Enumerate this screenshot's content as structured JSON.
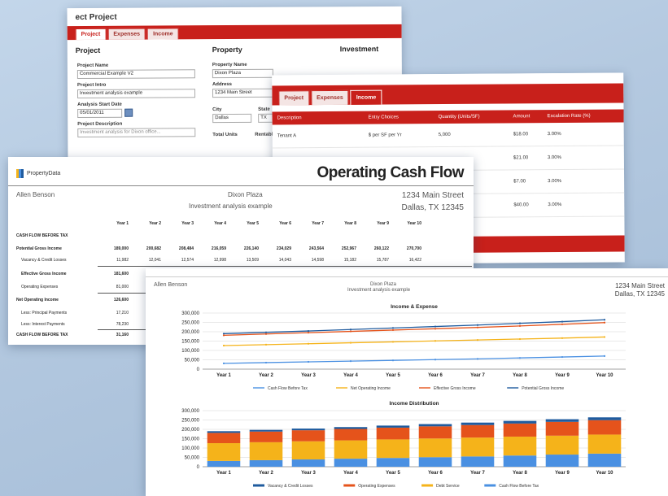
{
  "colors": {
    "brand_red": "#c8201b",
    "series_blue": "#4a90e2",
    "series_yellow": "#f5b31a",
    "series_orange": "#e5531b",
    "series_navy": "#1f5b9e",
    "series_gray": "#8aa0b8"
  },
  "card1": {
    "title": "ect Project",
    "tabs": [
      {
        "label": "Project",
        "active": true
      },
      {
        "label": "Expenses",
        "active": false
      },
      {
        "label": "Income",
        "active": false
      }
    ],
    "section_project": "Project",
    "section_property": "Property",
    "section_investment": "Investment",
    "project_name_label": "Project Name",
    "project_name_value": "Commercial Example V2",
    "project_intro_label": "Project Intro",
    "project_intro_value": "Investment analysis example",
    "analysis_start_label": "Analysis Start Date",
    "analysis_start_value": "05/01/2011",
    "project_desc_label": "Project Description",
    "project_desc_value": "Investment analysis for Dixon office...",
    "property_name_label": "Property Name",
    "property_name_value": "Dixon Plaza",
    "address_label": "Address",
    "address_value": "1234 Main Street",
    "city_label": "City",
    "city_value": "Dallas",
    "state_label": "State",
    "state_value": "TX",
    "total_units_label": "Total Units",
    "rentable_label": "Rentable"
  },
  "card2": {
    "tabs": [
      {
        "label": "Project",
        "active": false
      },
      {
        "label": "Expenses",
        "active": false
      },
      {
        "label": "Income",
        "active": true
      }
    ],
    "columns": [
      "Description",
      "Entry Choices",
      "Quantity (Units/SF)",
      "Amount",
      "Escalation Rate (%)"
    ],
    "rows": [
      [
        "Tenant A",
        "$ per SF per Yr",
        "5,000",
        "$18.00",
        "3.00%"
      ],
      [
        "",
        "",
        "",
        "$21.00",
        "3.00%"
      ],
      [
        "",
        "",
        "",
        "$7.00",
        "3.00%"
      ],
      [
        "",
        "",
        "",
        "$40.00",
        "3.00%"
      ]
    ]
  },
  "card3": {
    "logo_text": "PropertyData",
    "title": "Operating Cash Flow",
    "owner": "Allen Benson",
    "property": "Dixon Plaza",
    "subtitle": "Investment analysis example",
    "address": "1234 Main Street",
    "city_state": "Dallas, TX 12345",
    "years": [
      "Year 1",
      "Year 2",
      "Year 3",
      "Year 4",
      "Year 5",
      "Year 6",
      "Year 7",
      "Year 8",
      "Year 9",
      "Year 10"
    ],
    "section_label": "CASH FLOW BEFORE TAX",
    "rows": [
      {
        "label": "Potential Gross Income",
        "bold": true,
        "values": [
          "189,000",
          "200,682",
          "208,484",
          "216,059",
          "226,140",
          "234,029",
          "243,564",
          "252,967",
          "260,122",
          "270,700"
        ]
      },
      {
        "label": "Vacancy & Credit Losses",
        "bold": false,
        "values": [
          "11,982",
          "12,041",
          "12,574",
          "12,998",
          "13,509",
          "14,043",
          "14,598",
          "15,182",
          "15,787",
          "16,422"
        ]
      },
      {
        "label": "Effective Gross Income",
        "bold": true,
        "values": [
          "181,600"
        ]
      },
      {
        "label": "Operating Expenses",
        "bold": false,
        "values": [
          "81,000"
        ]
      },
      {
        "label": "Net Operating Income",
        "bold": true,
        "values": [
          "126,600"
        ]
      },
      {
        "label": "Less: Principal Payments",
        "bold": false,
        "values": [
          "17,210"
        ]
      },
      {
        "label": "Less: Interest Payments",
        "bold": false,
        "values": [
          "78,230"
        ]
      },
      {
        "label": "CASH FLOW BEFORE TAX",
        "bold": true,
        "values": [
          "31,160"
        ]
      }
    ]
  },
  "card4": {
    "owner": "Allen Benson",
    "property": "Dixon Plaza",
    "subtitle": "Investment analysis example",
    "address": "1234 Main Street",
    "city_state": "Dallas, TX 12345"
  },
  "chart_data": [
    {
      "type": "line",
      "title": "Income & Expense",
      "categories": [
        "Year 1",
        "Year 2",
        "Year 3",
        "Year 4",
        "Year 5",
        "Year 6",
        "Year 7",
        "Year 8",
        "Year 9",
        "Year 10"
      ],
      "ylim": [
        0,
        300000
      ],
      "yticks": [
        "300,000",
        "250,000",
        "200,000",
        "150,000",
        "100,000",
        "50,000",
        "0"
      ],
      "series": [
        {
          "name": "Cash Flow Before Tax",
          "color": "#4a90e2",
          "values": [
            31000,
            35000,
            39000,
            43000,
            47000,
            51000,
            55000,
            60000,
            65000,
            70000
          ]
        },
        {
          "name": "Net Operating Income",
          "color": "#f5b31a",
          "values": [
            126000,
            131000,
            136000,
            141000,
            146000,
            151000,
            156000,
            161000,
            166000,
            172000
          ]
        },
        {
          "name": "Effective Gross Income",
          "color": "#e5531b",
          "values": [
            181000,
            188000,
            195000,
            202000,
            209000,
            216000,
            223000,
            231000,
            240000,
            249000
          ]
        },
        {
          "name": "Potential Gross Income",
          "color": "#1f5b9e",
          "values": [
            190000,
            197000,
            204000,
            212000,
            220000,
            228000,
            236000,
            245000,
            254000,
            264000
          ]
        }
      ]
    },
    {
      "type": "bar",
      "stacked": true,
      "title": "Income Distribution",
      "categories": [
        "Year 1",
        "Year 2",
        "Year 3",
        "Year 4",
        "Year 5",
        "Year 6",
        "Year 7",
        "Year 8",
        "Year 9",
        "Year 10"
      ],
      "ylim": [
        0,
        300000
      ],
      "yticks": [
        "300,000",
        "250,000",
        "200,000",
        "150,000",
        "100,000",
        "50,000",
        "0"
      ],
      "series": [
        {
          "name": "Cash Flow Before Tax",
          "color": "#4a90e2",
          "values": [
            31000,
            35000,
            39000,
            43000,
            47000,
            51000,
            55000,
            60000,
            65000,
            70000
          ]
        },
        {
          "name": "Debt Service",
          "color": "#f5b31a",
          "values": [
            95000,
            96000,
            97000,
            98000,
            99000,
            100000,
            101000,
            101000,
            101000,
            102000
          ]
        },
        {
          "name": "Operating Expenses",
          "color": "#e5531b",
          "values": [
            55000,
            57000,
            59000,
            61000,
            63000,
            65000,
            67000,
            70000,
            74000,
            77000
          ]
        },
        {
          "name": "Vacancy & Credit Losses",
          "color": "#1f5b9e",
          "values": [
            9000,
            9000,
            9000,
            10000,
            11000,
            12000,
            13000,
            14000,
            14000,
            15000
          ]
        }
      ]
    }
  ]
}
